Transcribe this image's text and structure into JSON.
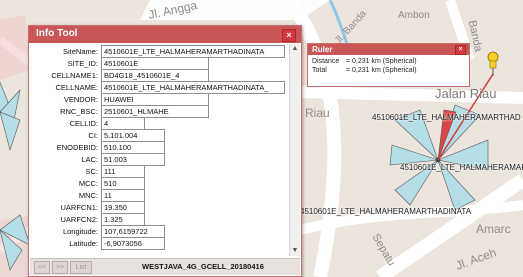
{
  "map": {
    "street_labels": [
      "Jl. Angga",
      "Jalan Riau",
      "Riau",
      "Banda",
      "Jl. Banda",
      "Sepatu",
      "Amarc",
      "Jl. Aceh",
      "Ambon"
    ],
    "site_labels": [
      "4510601E_LTE_HALMAHERAMARTHAD",
      "4510601E_LTE_HALMAHERAMAR",
      "4510601E_LTE_HALMAHERAMARTHADINATA"
    ]
  },
  "info_tool": {
    "title": "Info Tool",
    "close_label": "×",
    "fields": [
      {
        "label": "SiteName:",
        "value": "4510601E_LTE_HALMAHERAMARTHADINATA"
      },
      {
        "label": "SITE_ID:",
        "value": "4510601E"
      },
      {
        "label": "CELLNAME1:",
        "value": "BD4G18_4510601E_4"
      },
      {
        "label": "CELLNAME:",
        "value": "4510601E_LTE_HALMAHERAMARTHADINATA_"
      },
      {
        "label": "VENDOR:",
        "value": "HUAWEI"
      },
      {
        "label": "RNC_BSC:",
        "value": "2510601_HLMAHE"
      },
      {
        "label": "CELLID:",
        "value": "4"
      },
      {
        "label": "CI:",
        "value": "5.101.004"
      },
      {
        "label": "ENODEBID:",
        "value": "510.100"
      },
      {
        "label": "LAC:",
        "value": "51.003"
      },
      {
        "label": "SC:",
        "value": "111"
      },
      {
        "label": "MCC:",
        "value": "510"
      },
      {
        "label": "MNC:",
        "value": "11"
      },
      {
        "label": "UARFCN1:",
        "value": "19.350"
      },
      {
        "label": "UARFCN2:",
        "value": "1.325"
      },
      {
        "label": "Longitude:",
        "value": "107,6159722"
      },
      {
        "label": "Latitude:",
        "value": "-6,9073056"
      }
    ],
    "footer": {
      "prev_label": "<<",
      "next_label": ">>",
      "list_label": "List",
      "name": "WESTJAVA_4G_GCELL_20180416"
    }
  },
  "ruler": {
    "title": "Ruler",
    "close_label": "×",
    "distance_label": "Distance",
    "distance_value": "= 0,231 km (Spherical)",
    "total_label": "Total",
    "total_value": "= 0,231 km (Spherical)"
  }
}
